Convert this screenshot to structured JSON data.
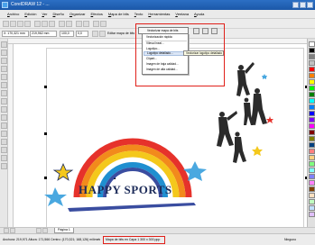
{
  "window": {
    "title": "CorelDRAW 12 - ..."
  },
  "menu": [
    "Archivo",
    "Edición",
    "Ver",
    "Diseño",
    "Organizar",
    "Efectos",
    "Mapa de bits",
    "Texto",
    "Herramientas",
    "Ventana",
    "Ayuda"
  ],
  "property_bar": {
    "x": "X: 170,321 mm",
    "y": "Y: 168,126 mm",
    "w": "219,962 mm",
    "h": "171,566 mm",
    "scale_w": "100,0",
    "scale_h": "100,0",
    "angle": "0,0",
    "edit_bitmap": "Editar mapa de bits"
  },
  "dropdown": {
    "split_button_label": "Vectorizar mapa de bits",
    "items": [
      {
        "label": "Vectorización rápida"
      },
      {
        "label": "Vilesa lineal..."
      },
      {
        "label": "Logotipo..."
      },
      {
        "label": "Logotipo detallado..."
      },
      {
        "label": "Clipart..."
      },
      {
        "label": "Imagen de baja calidad..."
      },
      {
        "label": "Imagen de alta calidad..."
      }
    ],
    "tooltip": "Vectorizar logotipo detallado"
  },
  "canvas": {
    "logo_text": "HAPPY SPORTS"
  },
  "page_tab": "Página 1",
  "status": {
    "left_text": "Anchura: 219,971 Altura: 171,566 Centro: (170,321; 168,126) milímetros",
    "selected_object": "Mapa de bits en Capa 1 300 x 300 ppp",
    "right_text": "Ninguno"
  },
  "colors": {
    "accent": "#e0201a",
    "title_bar": "#1b58a8",
    "logo_text": "#1c2b59",
    "rainbow": [
      "#e6322b",
      "#f28a1c",
      "#f4c81c",
      "#ffffff",
      "#1f8fd0",
      "#3a4da0"
    ],
    "palette": [
      "#ffffff",
      "#000000",
      "#808080",
      "#c0c0c0",
      "#ff0000",
      "#ff8000",
      "#ffff00",
      "#00ff00",
      "#008000",
      "#00ffff",
      "#0080ff",
      "#0000ff",
      "#8000ff",
      "#ff00ff",
      "#800000",
      "#808000",
      "#004080",
      "#ff8080",
      "#ffd080",
      "#80ff80",
      "#80ffff",
      "#8080ff",
      "#ff80ff",
      "#804000",
      "#ffe0c0",
      "#c0ffc0",
      "#c0e0ff",
      "#e0c0ff"
    ]
  }
}
